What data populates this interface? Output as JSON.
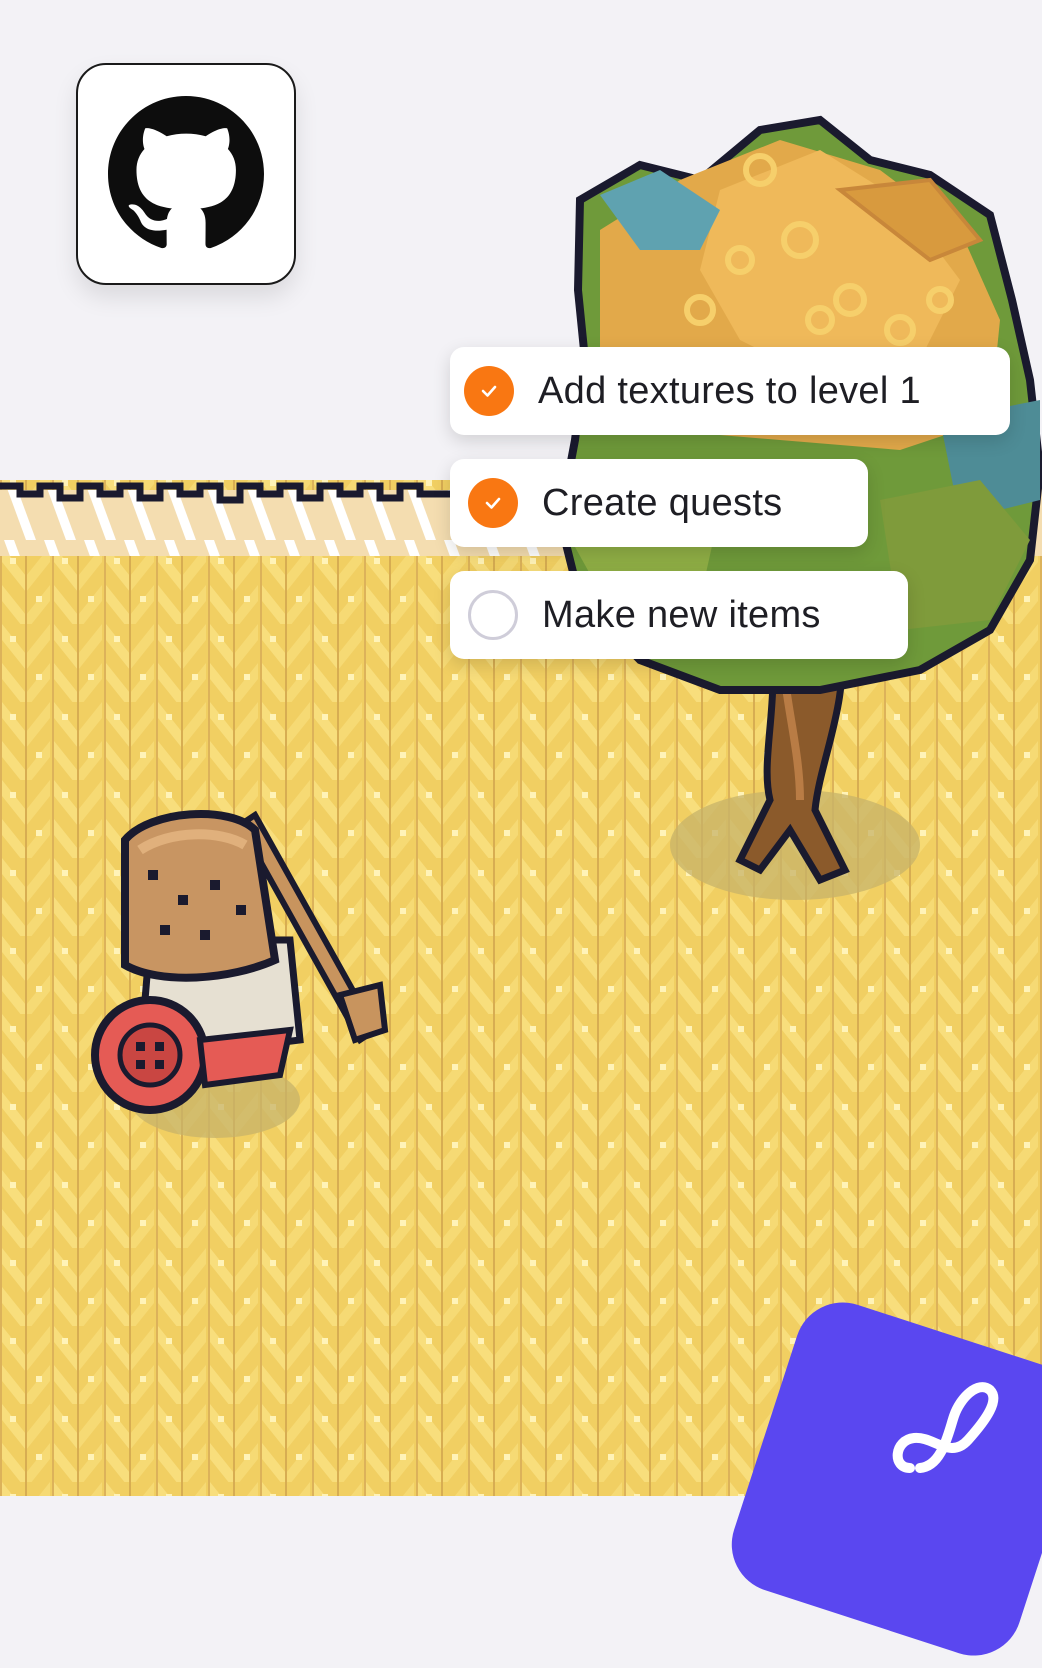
{
  "tasks": [
    {
      "label": "Add textures to level 1",
      "done": true
    },
    {
      "label": "Create quests",
      "done": true
    },
    {
      "label": "Make new items",
      "done": false
    }
  ],
  "icons": {
    "app": "github-icon",
    "check": "check-icon",
    "badge": "infinity-icon"
  },
  "colors": {
    "sky": "#f3f2f6",
    "wheat": "#f2d36a",
    "wheat_dark": "#d9a441",
    "check_orange": "#f97712",
    "badge_purple": "#5a47f0"
  }
}
